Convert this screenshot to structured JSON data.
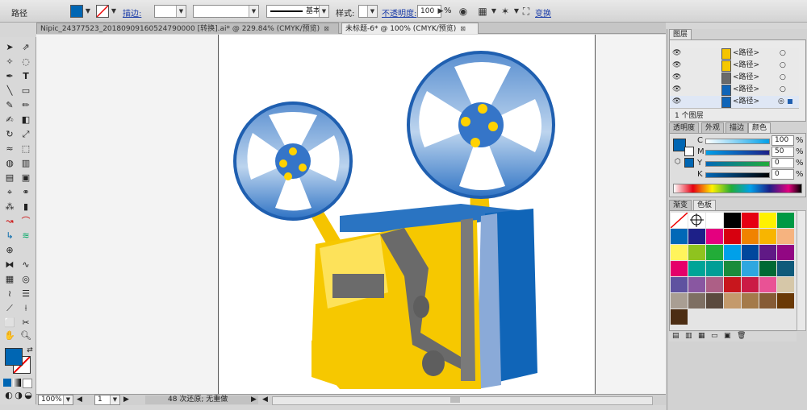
{
  "control_bar": {
    "object_type": "路径",
    "stroke_label": "描边:",
    "stroke_style": "基本",
    "style_label": "样式:",
    "opacity_label": "不透明度:",
    "opacity_value": "100",
    "opacity_unit": "%",
    "transform_label": "变换"
  },
  "tabs": [
    {
      "label": "Nipic_24377523_20180909160524790000  [转换].ai* @ 229.84% (CMYK/预览)",
      "close": "⊠"
    },
    {
      "label": "未标题-6* @ 100% (CMYK/预览)",
      "close": "⊠"
    }
  ],
  "status_bar": {
    "zoom": "100%",
    "page": "1",
    "message": "48 次还原; 无重做"
  },
  "layers_panel": {
    "title": "图层",
    "rows": [
      "<路径>",
      "<路径>",
      "<路径>",
      "<路径>",
      "<路径>"
    ],
    "footer": "1 个图层"
  },
  "color_panel": {
    "tabs": [
      "透明度",
      "外观",
      "描边",
      "颜色"
    ],
    "channels": [
      {
        "name": "C",
        "value": "100",
        "unit": "%"
      },
      {
        "name": "M",
        "value": "50",
        "unit": "%"
      },
      {
        "name": "Y",
        "value": "0",
        "unit": "%"
      },
      {
        "name": "K",
        "value": "0",
        "unit": "%"
      }
    ],
    "fill_color": "#0066b3"
  },
  "swatches_panel": {
    "tabs": [
      "渐变",
      "色板"
    ],
    "colors": [
      "#ffffff",
      "#000000",
      "#e60012",
      "#fff100",
      "#009944",
      "#0068b7",
      "#1d2088",
      "#e4007f",
      "#d7000f",
      "#f08300",
      "#f8b500",
      "#f6b37f",
      "#fff45c",
      "#8fc31f",
      "#22ac38",
      "#00a0e9",
      "#00479d",
      "#601986",
      "#920783",
      "#e5006a",
      "#00a497",
      "#009e96",
      "#1a8c3c",
      "#2ea7e0",
      "#006934",
      "#0f5a7a",
      "#5f52a0",
      "#8957a1",
      "#ad5f86",
      "#c8161d",
      "#cb1b45",
      "#e95295",
      "#d6c7a8",
      "#a99e93",
      "#7e6f63",
      "#5b4a3e",
      "#c49a6c",
      "#a47a4a",
      "#865b35",
      "#6a3906",
      "#4c2d13"
    ]
  }
}
